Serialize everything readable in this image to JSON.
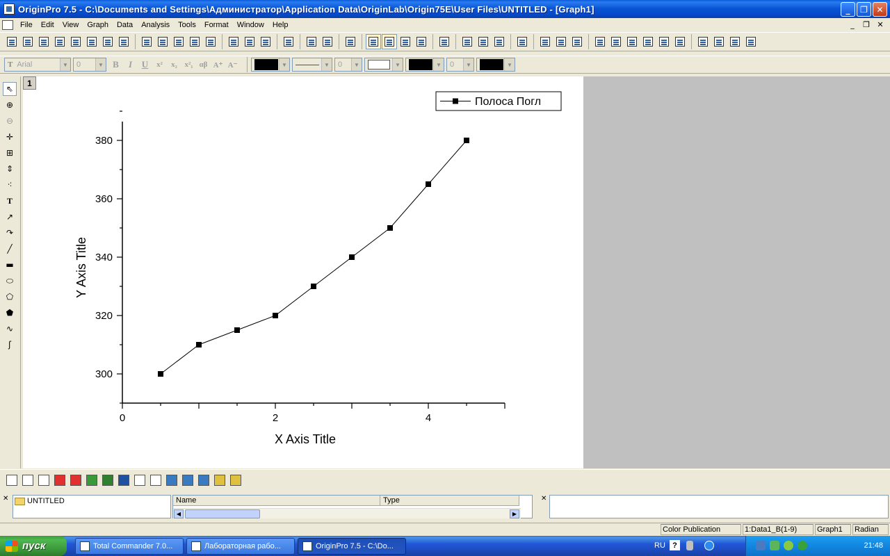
{
  "window": {
    "title": "OriginPro 7.5 - C:\\Documents and Settings\\Администратор\\Application Data\\OriginLab\\Origin75E\\User Files\\UNTITLED - [Graph1]",
    "min_glyph": "_",
    "max_glyph": "❐",
    "close_glyph": "✕"
  },
  "menu": {
    "items": [
      "File",
      "Edit",
      "View",
      "Graph",
      "Data",
      "Analysis",
      "Tools",
      "Format",
      "Window",
      "Help"
    ],
    "mdi_min": "_",
    "mdi_restore": "❐",
    "mdi_close": "✕"
  },
  "format_toolbar": {
    "font_name": "Arial",
    "font_size": "0",
    "bold": "B",
    "italic": "I",
    "underline": "U",
    "superscript": "x²",
    "subscript": "x₂",
    "supersub": "x²₁",
    "greek": "αβ",
    "increase": "A⁺",
    "decrease": "A⁻",
    "line_width": "0",
    "pattern_width": "0"
  },
  "graph": {
    "layer_number": "1",
    "legend_text": "Полоса Погл"
  },
  "chart_data": {
    "type": "line",
    "markers": "filled-square",
    "x": [
      0.5,
      1.0,
      1.5,
      2.0,
      2.5,
      3.0,
      3.5,
      4.0,
      4.5
    ],
    "series": [
      {
        "name": "Полоса Погл",
        "values": [
          300,
          310,
          315,
          320,
          330,
          340,
          350,
          365,
          380
        ]
      }
    ],
    "xlabel": "X Axis Title",
    "ylabel": "Y Axis Title",
    "xlim": [
      0,
      5
    ],
    "ylim": [
      290,
      390
    ],
    "x_ticks": [
      0,
      2,
      4
    ],
    "y_ticks": [
      300,
      320,
      340,
      360,
      380
    ],
    "grid": false,
    "legend_position": "top-right",
    "line_color": "#000000"
  },
  "explorer": {
    "folder": "UNTITLED",
    "col_name": "Name",
    "col_type": "Type",
    "close_glyph": "✕"
  },
  "status": {
    "theme": "Color Publication",
    "active_data": "1:Data1_B(1-9)",
    "active_window": "Graph1",
    "angle_unit": "Radian"
  },
  "taskbar": {
    "start_label": "пуск",
    "items": [
      "Total Commander 7.0...",
      "Лабораторная рабо...",
      "OriginPro 7.5 - C:\\Do..."
    ],
    "language": "RU",
    "help": "?",
    "clock": "21:48"
  }
}
